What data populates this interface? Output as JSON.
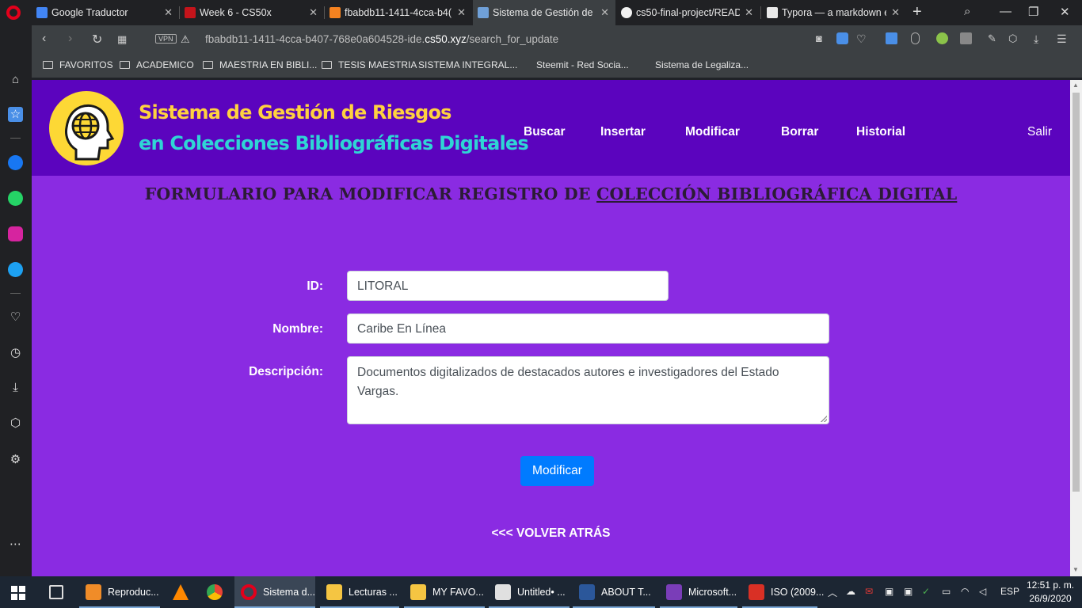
{
  "browser": {
    "tabs": [
      {
        "title": "Google Traductor",
        "color": "#4285f4"
      },
      {
        "title": "Week 6 - CS50x",
        "color": "#c4141b"
      },
      {
        "title": "fbabdb11-1411-4cca-b4(",
        "color": "#f58220"
      },
      {
        "title": "Sistema de Gestión de R",
        "color": "#6fa0d8"
      },
      {
        "title": "cs50-final-project/READ",
        "color": "#f2f2f2"
      },
      {
        "title": "Typora — a markdown e",
        "color": "#e9e9e9"
      }
    ],
    "address": {
      "prefix": "fbabdb11-1411-4cca-b407-768e0a604528-ide.",
      "domain": "cs50.xyz",
      "path": "/search_for_update"
    },
    "vpn_label": "VPN",
    "bookmarks": [
      {
        "label": "FAVORITOS",
        "type": "folder"
      },
      {
        "label": "ACADEMICO",
        "type": "folder"
      },
      {
        "label": "MAESTRIA EN BIBLI...",
        "type": "folder"
      },
      {
        "label": "TESIS MAESTRIA",
        "type": "folder"
      },
      {
        "label": "SISTEMA INTEGRAL...",
        "type": "page"
      },
      {
        "label": "Steemit - Red Socia...",
        "type": "site"
      },
      {
        "label": "Sistema de Legaliza...",
        "type": "site"
      }
    ]
  },
  "site": {
    "brand_line1": "Sistema de Gestión de Riesgos",
    "brand_line2": "en Colecciones Bibliográficas Digitales",
    "nav": [
      "Buscar",
      "Insertar",
      "Modificar",
      "Borrar",
      "Historial"
    ],
    "logout": "Salir",
    "colors": {
      "header": "#5b04be",
      "body": "#8a2be2",
      "brand1": "#ffd23f",
      "brand2": "#2fd5d5",
      "button": "#007bff"
    }
  },
  "form": {
    "title_prefix": "FORMULARIO PARA MODIFICAR REGISTRO DE ",
    "title_underlined": "COLECCIÓN BIBLIOGRÁFICA DIGITAL",
    "id_label": "ID:",
    "id_value": "LITORAL",
    "name_label": "Nombre:",
    "name_value": "Caribe En Línea",
    "desc_label": "Descripción:",
    "desc_value": "Documentos digitalizados de destacados autores e investigadores del Estado Vargas.",
    "submit": "Modificar",
    "back": "<<< VOLVER ATRÁS"
  },
  "taskbar": {
    "apps": [
      {
        "label": "Reproduc...",
        "color": "#f08c28"
      },
      {
        "label": "",
        "color": "#ff8800"
      },
      {
        "label": "",
        "color": "#34a853"
      },
      {
        "label": "Sistema d...",
        "color": "#e3001b"
      },
      {
        "label": "Lecturas ...",
        "color": "#f5c542"
      },
      {
        "label": "MY FAVO...",
        "color": "#f5c542"
      },
      {
        "label": "Untitled• ...",
        "color": "#e0e0e0"
      },
      {
        "label": "ABOUT T...",
        "color": "#2b579a"
      },
      {
        "label": "Microsoft...",
        "color": "#7a3db8"
      },
      {
        "label": "ISO (2009...",
        "color": "#d93025"
      }
    ],
    "language": "ESP",
    "time": "12:51 p. m.",
    "date": "26/9/2020"
  }
}
